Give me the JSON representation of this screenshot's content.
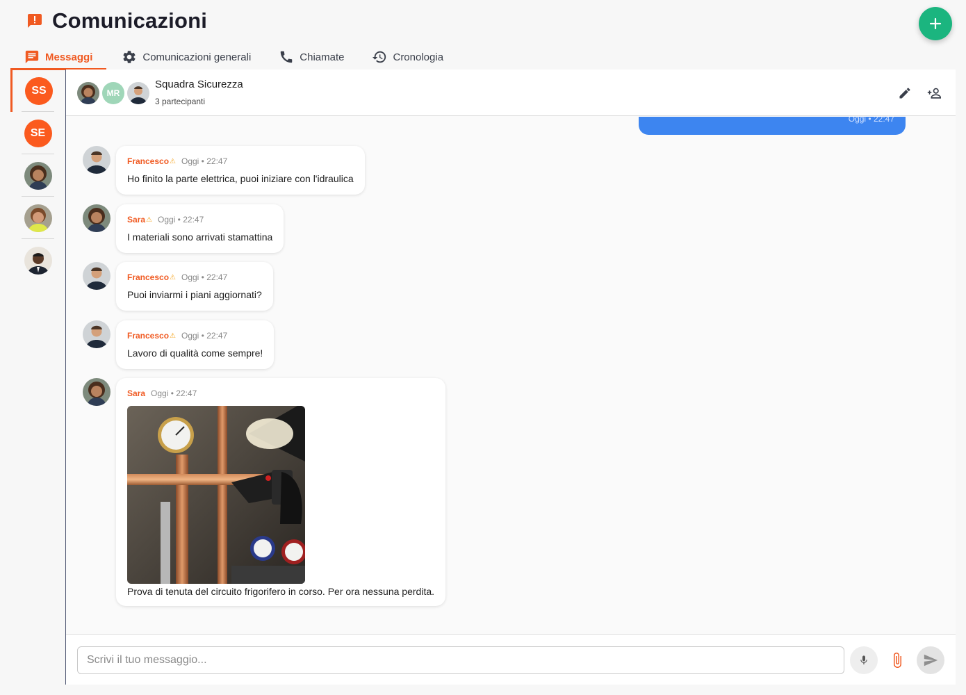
{
  "app": {
    "title": "Comunicazioni",
    "accent_color": "#f05a22",
    "fab_color": "#1bb57f",
    "fab_icon": "plus-icon"
  },
  "tabs": [
    {
      "label": "Messaggi",
      "icon": "message-icon",
      "active": true
    },
    {
      "label": "Comunicazioni generali",
      "icon": "gear-icon",
      "active": false
    },
    {
      "label": "Chiamate",
      "icon": "phone-icon",
      "active": false
    },
    {
      "label": "Cronologia",
      "icon": "history-icon",
      "active": false
    }
  ],
  "conversations": [
    {
      "type": "initials",
      "initials": "SS",
      "active": true
    },
    {
      "type": "initials",
      "initials": "SE",
      "active": false
    },
    {
      "type": "avatar",
      "icon": "woman-avatar"
    },
    {
      "type": "avatar",
      "icon": "woman-vest-avatar"
    },
    {
      "type": "avatar",
      "icon": "man-avatar"
    }
  ],
  "chat": {
    "name": "Squadra Sicurezza",
    "participants_label": "3 partecipanti",
    "header_initials": "MR",
    "edit_icon": "pencil-icon",
    "add_person_icon": "person-add-icon",
    "outgoing_meta": "Oggi • 22:47",
    "outgoing_color": "#3d85f0"
  },
  "messages": [
    {
      "sender": "Francesco",
      "flag": "⚠",
      "time": "Oggi • 22:47",
      "text": "Ho finito la parte elettrica, puoi iniziare con l'idraulica"
    },
    {
      "sender": "Sara",
      "flag": "⚠",
      "time": "Oggi • 22:47",
      "text": "I materiali sono arrivati stamattina"
    },
    {
      "sender": "Francesco",
      "flag": "⚠",
      "time": "Oggi • 22:47",
      "text": "Puoi inviarmi i piani aggiornati?"
    },
    {
      "sender": "Francesco",
      "flag": "⚠",
      "time": "Oggi • 22:47",
      "text": "Lavoro di qualità come sempre!"
    },
    {
      "sender": "Sara",
      "time": "Oggi • 22:47",
      "image": "pressure-gauge-photo",
      "text": "Prova di tenuta del circuito frigorifero in corso. Per ora nessuna perdita."
    }
  ],
  "composer": {
    "placeholder": "Scrivi il tuo messaggio...",
    "mic_icon": "microphone-icon",
    "attach_icon": "paperclip-icon",
    "send_icon": "send-icon"
  }
}
